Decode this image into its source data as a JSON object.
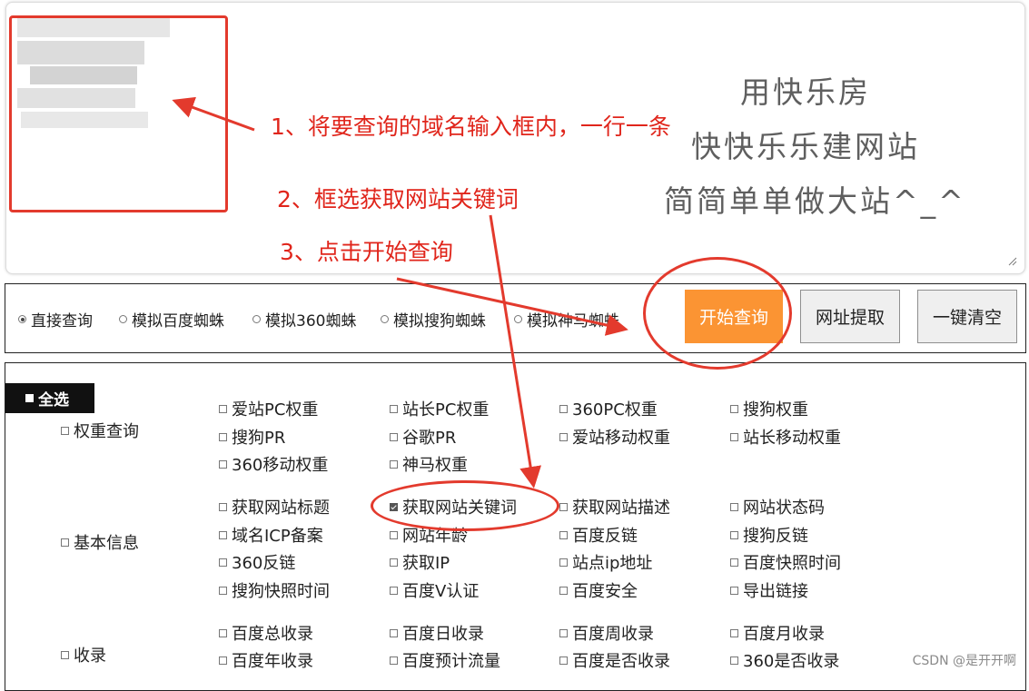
{
  "placeholder_lines": [
    "用快乐房",
    "快快乐乐建网站",
    "简简单单做大站^_^"
  ],
  "annotations": {
    "step1": "1、将要查询的域名输入框内，一行一条",
    "step2": "2、框选获取网站关键词",
    "step3": "3、点击开始查询",
    "color": "#e0251b"
  },
  "query_modes": [
    {
      "label": "直接查询",
      "selected": true
    },
    {
      "label": "模拟百度蜘蛛",
      "selected": false
    },
    {
      "label": "模拟360蜘蛛",
      "selected": false
    },
    {
      "label": "模拟搜狗蜘蛛",
      "selected": false
    },
    {
      "label": "模拟神马蜘蛛",
      "selected": false
    }
  ],
  "buttons": {
    "start": "开始查询",
    "extract": "网址提取",
    "clear": "一键清空",
    "start_color": "#fb9433"
  },
  "select_all": "全选",
  "groups": [
    {
      "label": "权重查询",
      "items": [
        {
          "label": "爱站PC权重",
          "checked": false
        },
        {
          "label": "站长PC权重",
          "checked": false
        },
        {
          "label": "360PC权重",
          "checked": false
        },
        {
          "label": "搜狗权重",
          "checked": false
        },
        {
          "label": "搜狗PR",
          "checked": false
        },
        {
          "label": "谷歌PR",
          "checked": false
        },
        {
          "label": "爱站移动权重",
          "checked": false
        },
        {
          "label": "站长移动权重",
          "checked": false
        },
        {
          "label": "360移动权重",
          "checked": false
        },
        {
          "label": "神马权重",
          "checked": false
        }
      ]
    },
    {
      "label": "基本信息",
      "items": [
        {
          "label": "获取网站标题",
          "checked": false
        },
        {
          "label": "获取网站关键词",
          "checked": true
        },
        {
          "label": "获取网站描述",
          "checked": false
        },
        {
          "label": "网站状态码",
          "checked": false
        },
        {
          "label": "域名ICP备案",
          "checked": false
        },
        {
          "label": "网站年龄",
          "checked": false
        },
        {
          "label": "百度反链",
          "checked": false
        },
        {
          "label": "搜狗反链",
          "checked": false
        },
        {
          "label": "360反链",
          "checked": false
        },
        {
          "label": "获取IP",
          "checked": false
        },
        {
          "label": "站点ip地址",
          "checked": false
        },
        {
          "label": "百度快照时间",
          "checked": false
        },
        {
          "label": "搜狗快照时间",
          "checked": false
        },
        {
          "label": "百度V认证",
          "checked": false
        },
        {
          "label": "百度安全",
          "checked": false
        },
        {
          "label": "导出链接",
          "checked": false
        }
      ]
    },
    {
      "label": "收录",
      "items": [
        {
          "label": "百度总收录",
          "checked": false
        },
        {
          "label": "百度日收录",
          "checked": false
        },
        {
          "label": "百度周收录",
          "checked": false
        },
        {
          "label": "百度月收录",
          "checked": false
        },
        {
          "label": "百度年收录",
          "checked": false
        },
        {
          "label": "百度预计流量",
          "checked": false
        },
        {
          "label": "百度是否收录",
          "checked": false
        },
        {
          "label": "360是否收录",
          "checked": false
        }
      ]
    }
  ],
  "watermark": "CSDN @是开开啊"
}
